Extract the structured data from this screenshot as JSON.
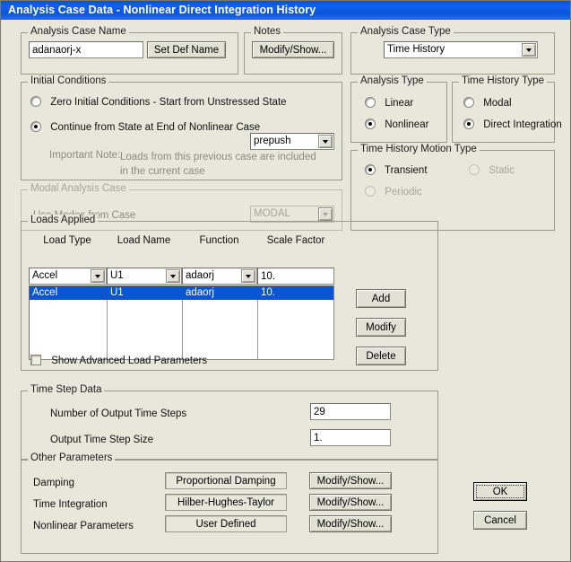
{
  "window": {
    "title": "Analysis Case Data  -  Nonlinear Direct Integration History"
  },
  "analysis_case_name": {
    "group_label": "Analysis Case Name",
    "value": "adanaorj-x",
    "set_def_name_button": "Set Def Name"
  },
  "notes": {
    "group_label": "Notes",
    "modify_show_button": "Modify/Show..."
  },
  "analysis_case_type": {
    "group_label": "Analysis Case Type",
    "selected": "Time History"
  },
  "initial_conditions": {
    "group_label": "Initial Conditions",
    "option_zero": "Zero Initial Conditions - Start from Unstressed State",
    "option_continue": "Continue from State at End of Nonlinear Case",
    "selected": "continue",
    "case_combo_value": "prepush",
    "note_label": "Important Note:",
    "note_text": "Loads from this previous case are included in the current case"
  },
  "modal_analysis_case": {
    "group_label": "Modal Analysis Case",
    "use_modes_label": "Use Modes from Case",
    "combo_value": "MODAL",
    "enabled": false
  },
  "analysis_type": {
    "group_label": "Analysis Type",
    "options": [
      "Linear",
      "Nonlinear"
    ],
    "selected": "Nonlinear"
  },
  "time_history_type": {
    "group_label": "Time History Type",
    "options": [
      "Modal",
      "Direct Integration"
    ],
    "selected": "Direct Integration"
  },
  "time_history_motion_type": {
    "group_label": "Time History Motion Type",
    "option_transient": "Transient",
    "option_static": "Static",
    "option_periodic": "Periodic",
    "selected": "Transient",
    "static_enabled": false,
    "periodic_enabled": false
  },
  "loads_applied": {
    "group_label": "Loads Applied",
    "columns": [
      "Load Type",
      "Load Name",
      "Function",
      "Scale Factor"
    ],
    "editor_row": {
      "load_type": "Accel",
      "load_name": "U1",
      "function": "adaorj",
      "scale_factor": "10."
    },
    "rows": [
      {
        "load_type": "Accel",
        "load_name": "U1",
        "function": "adaorj",
        "scale_factor": "10.",
        "selected": true
      }
    ],
    "add_button": "Add",
    "modify_button": "Modify",
    "delete_button": "Delete",
    "show_advanced_checkbox": "Show Advanced Load Parameters",
    "show_advanced_checked": false
  },
  "time_step_data": {
    "group_label": "Time Step Data",
    "number_of_steps_label": "Number of Output Time Steps",
    "number_of_steps_value": "29",
    "step_size_label": "Output Time Step Size",
    "step_size_value": "1."
  },
  "other_parameters": {
    "group_label": "Other Parameters",
    "rows": [
      {
        "label": "Damping",
        "value": "Proportional Damping",
        "button": "Modify/Show..."
      },
      {
        "label": "Time Integration",
        "value": "Hilber-Hughes-Taylor",
        "button": "Modify/Show..."
      },
      {
        "label": "Nonlinear Parameters",
        "value": "User Defined",
        "button": "Modify/Show..."
      }
    ]
  },
  "dialog_buttons": {
    "ok": "OK",
    "cancel": "Cancel"
  },
  "colors": {
    "titlebar_blue": "#0f5ce4",
    "dialog_face": "#e9e7db",
    "selection_blue": "#0a55d4",
    "disabled_text": "#a8a69c"
  }
}
